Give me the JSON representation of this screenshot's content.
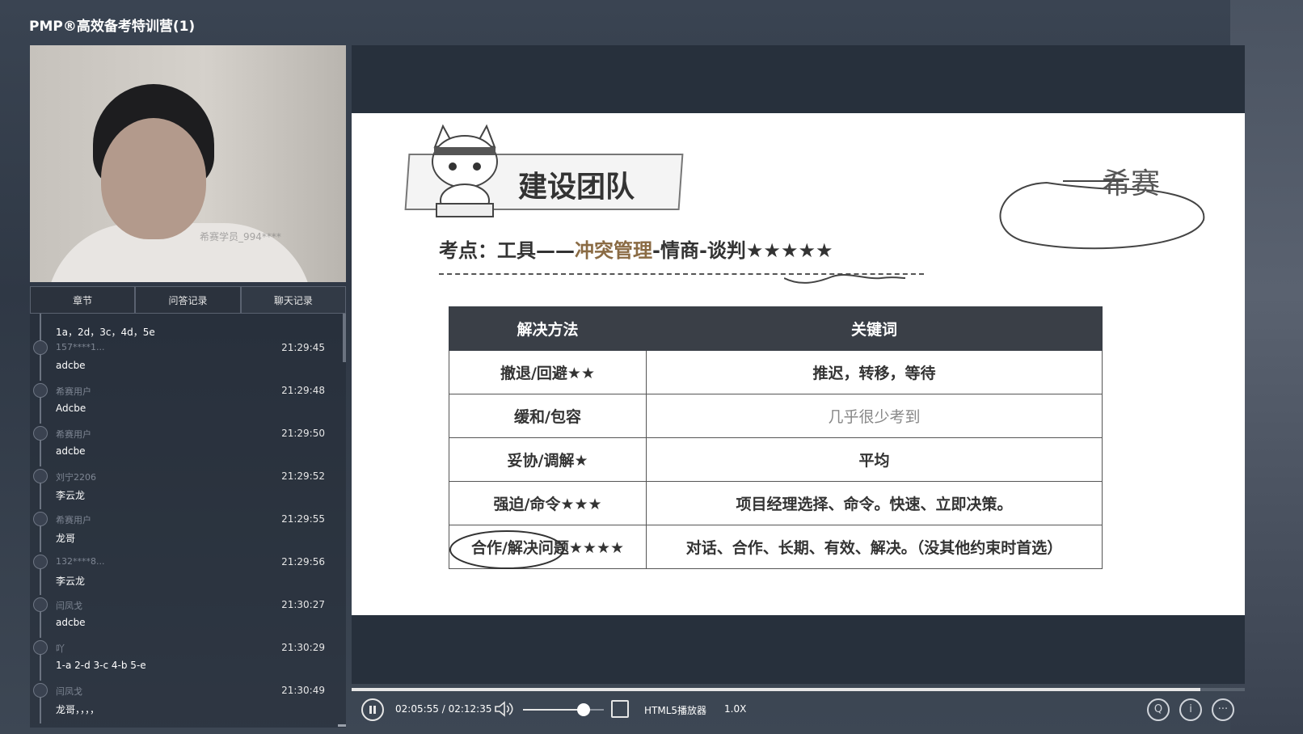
{
  "app": {
    "title": "PMP®高效备考特训营(1)"
  },
  "video": {
    "watermark": "希赛学员_994****"
  },
  "tabs": [
    {
      "label": "章节"
    },
    {
      "label": "问答记录"
    },
    {
      "label": "聊天记录",
      "active": true
    }
  ],
  "chat": {
    "first_text": "1a，2d，3c，4d，5e",
    "messages": [
      {
        "user": "157****1...",
        "time": "21:29:45",
        "text": "adcbe"
      },
      {
        "user": "希赛用户",
        "time": "21:29:48",
        "text": "Adcbe"
      },
      {
        "user": "希赛用户",
        "time": "21:29:50",
        "text": "adcbe"
      },
      {
        "user": "刘宁2206",
        "time": "21:29:52",
        "text": "李云龙"
      },
      {
        "user": "希赛用户",
        "time": "21:29:55",
        "text": "龙哥"
      },
      {
        "user": "132****8...",
        "time": "21:29:56",
        "text": "李云龙"
      },
      {
        "user": "闫凤戈",
        "time": "21:30:27",
        "text": "adcbe"
      },
      {
        "user": "吖",
        "time": "21:30:29",
        "text": "1-a 2-d 3-c 4-b 5-e"
      },
      {
        "user": "闫凤戈",
        "time": "21:30:49",
        "text": "龙哥，，，，"
      }
    ]
  },
  "slide": {
    "heading": "建设团队",
    "brand": "希赛",
    "exam_point_prefix": "考点：工具——",
    "exam_point_highlight": "冲突管理",
    "exam_point_suffix": "-情商-谈判★★★★★",
    "table": {
      "headers": [
        "解决方法",
        "关键词"
      ],
      "rows": [
        {
          "method": "撤退/回避★★",
          "keywords": "推迟，转移，等待"
        },
        {
          "method": "缓和/包容",
          "keywords": "几乎很少考到"
        },
        {
          "method": "妥协/调解★",
          "keywords": "平均"
        },
        {
          "method": "强迫/命令★★★",
          "keywords": "项目经理选择、命令。快速、立即决策。"
        },
        {
          "method": "合作/解决问题★★★★",
          "keywords": "对话、合作、长期、有效、解决。（没其他约束时首选）"
        }
      ]
    }
  },
  "player": {
    "time": "02:05:55 / 02:12:35",
    "progress": 0.95,
    "volume": 0.75,
    "name": "HTML5播放器",
    "speed": "1.0X"
  },
  "icons": {
    "pause": "pause-icon",
    "volume": "volume-icon",
    "fullscreen": "fullscreen-icon",
    "qa": "qa-icon",
    "info": "info-icon",
    "more": "more-icon"
  }
}
